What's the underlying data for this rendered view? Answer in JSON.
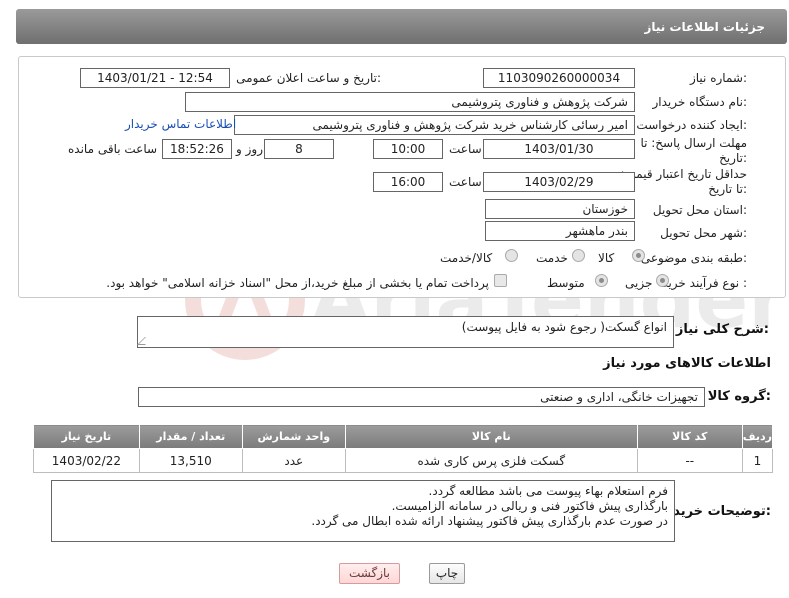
{
  "header": {
    "title": "جزئیات اطلاعات نیاز"
  },
  "form": {
    "need_number": {
      "label": "شماره نیاز:",
      "value": "1103090260000034"
    },
    "announce_datetime": {
      "label": "تاریخ و ساعت اعلان عمومی:",
      "value": "1403/01/21 - 12:54"
    },
    "buyer_org": {
      "label": "نام دستگاه خریدار:",
      "value": "شرکت پژوهش و فناوری پتروشیمی"
    },
    "requester": {
      "label": "ایجاد کننده درخواست:",
      "value": "امیر رسائی کارشناس خرید شرکت پژوهش و فناوری پتروشیمی",
      "contact_link": "اطلاعات تماس خریدار"
    },
    "reply_deadline": {
      "label": "مهلت ارسال پاسخ: تا تاریخ:",
      "date": "1403/01/30",
      "time_label": "ساعت",
      "time": "10:00",
      "days": "8",
      "days_label": "روز و",
      "remaining": "18:52:26",
      "remaining_label": "ساعت باقی مانده"
    },
    "price_validity": {
      "label": "حداقل تاریخ اعتبار قیمت: تا تاریخ:",
      "date": "1403/02/29",
      "time_label": "ساعت",
      "time": "16:00"
    },
    "delivery_province": {
      "label": "استان محل تحویل:",
      "value": "خوزستان"
    },
    "delivery_city": {
      "label": "شهر محل تحویل:",
      "value": "بندر ماهشهر"
    },
    "category": {
      "label": "طبقه بندی موضوعی:",
      "options": [
        "کالا",
        "خدمت",
        "کالا/خدمت"
      ],
      "selected": "کالا"
    },
    "purchase_type": {
      "label": "نوع فرآیند خرید :",
      "options": [
        "جزیی",
        "متوسط"
      ],
      "selected": "جزیی",
      "payment_note": "پرداخت تمام یا بخشی از مبلغ خرید،از محل \"اسناد خزانه اسلامی\" خواهد بود."
    }
  },
  "description": {
    "label": "شرح کلی نیاز:",
    "value": "انواع گسکت( رجوع شود به فایل پیوست)"
  },
  "goods_section": {
    "title": "اطلاعات کالاهای مورد نیاز"
  },
  "goods_group": {
    "label": "گروه کالا:",
    "value": "تجهیزات خانگی، اداری و صنعتی"
  },
  "table": {
    "headers": [
      "ردیف",
      "کد کالا",
      "نام کالا",
      "واحد شمارش",
      "تعداد / مقدار",
      "تاریخ نیاز"
    ],
    "rows": [
      [
        "1",
        "--",
        "گسکت فلزی پرس کاری شده",
        "عدد",
        "13,510",
        "1403/02/22"
      ]
    ]
  },
  "buyer_notes": {
    "label": "توضیحات خریدار:",
    "lines": [
      "فرم استعلام بهاء پیوست می باشد مطالعه گردد.",
      "بارگذاری پیش فاکتور فنی و ریالی در سامانه الزامیست.",
      "در صورت عدم بارگذاری پیش فاکتور پیشنهاد ارائه شده ابطال می گردد."
    ]
  },
  "buttons": {
    "print": "چاپ",
    "back": "بازگشت"
  },
  "colors": {
    "header_bg": "#7f7f7f",
    "link": "#1a4fb5",
    "back_button": "#ffd6d6"
  }
}
